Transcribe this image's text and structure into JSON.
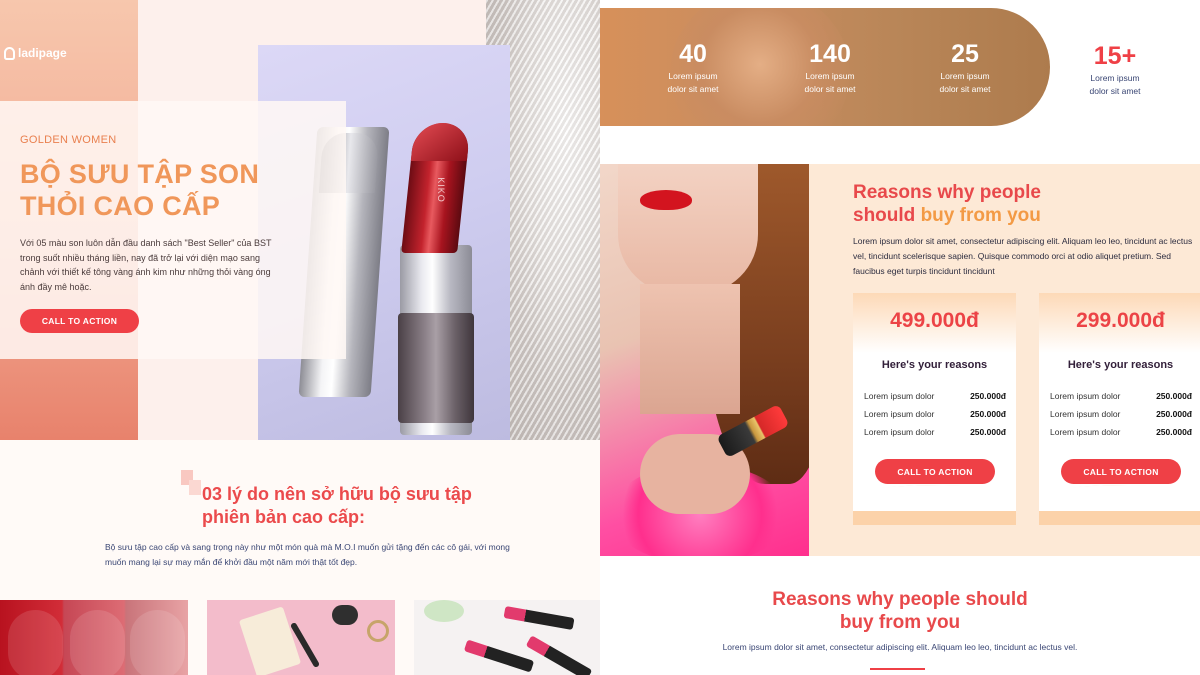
{
  "brand": {
    "logo_text": "ladipage"
  },
  "hero": {
    "subtitle": "GOLDEN WOMEN",
    "title": "BỘ SƯU TẬP SON THỎI CAO CẤP",
    "description": "Với 05 màu son luôn dẫn đầu danh sách \"Best Seller\" của BST trong suốt nhiều tháng liền, nay đã trở lại với diện mạo sang chảnh với thiết kế tông vàng ánh kim như những thỏi vàng óng ánh đầy mê hoặc.",
    "cta": "CALL TO ACTION",
    "lipstick_brand": "KIKO"
  },
  "section2": {
    "title": "03 lý do nên sở hữu bộ sưu tập phiên bản cao cấp:",
    "description": "Bộ sưu tập cao cấp và sang trọng này như một món quà mà M.O.I muốn gửi tặng đến các cô gái, với mong muốn mang lại sự may mắn để khởi đầu một năm mới thật tốt đẹp."
  },
  "stats": [
    {
      "number": "40",
      "label_1": "Lorem ipsum",
      "label_2": "dolor sit amet"
    },
    {
      "number": "140",
      "label_1": "Lorem ipsum",
      "label_2": "dolor sit amet"
    },
    {
      "number": "25",
      "label_1": "Lorem ipsum",
      "label_2": "dolor sit amet"
    },
    {
      "number": "15+",
      "label_1": "Lorem ipsum",
      "label_2": "dolor sit amet"
    }
  ],
  "reasons": {
    "title_part1": "Reasons why people",
    "title_part2": "should",
    "title_highlight": "buy from you",
    "description": "Lorem ipsum dolor sit amet, consectetur adipiscing elit. Aliquam leo leo, tincidunt ac lectus vel, tincidunt scelerisque sapien. Quisque commodo orci at odio aliquet pretium. Sed faucibus eget turpis tincidunt tincidunt"
  },
  "pricing_cards": [
    {
      "price": "499.000đ",
      "heading": "Here's your reasons",
      "rows": [
        {
          "label": "Lorem ipsum dolor",
          "value": "250.000đ"
        },
        {
          "label": "Lorem ipsum dolor",
          "value": "250.000đ"
        },
        {
          "label": "Lorem ipsum dolor",
          "value": "250.000đ"
        }
      ],
      "cta": "CALL TO ACTION"
    },
    {
      "price": "299.000đ",
      "heading": "Here's your reasons",
      "rows": [
        {
          "label": "Lorem ipsum dolor",
          "value": "250.000đ"
        },
        {
          "label": "Lorem ipsum dolor",
          "value": "250.000đ"
        },
        {
          "label": "Lorem ipsum dolor",
          "value": "250.000đ"
        }
      ],
      "cta": "CALL TO ACTION"
    }
  ],
  "reasons2": {
    "title_line1": "Reasons why people should",
    "title_line2": "buy from you",
    "description": "Lorem ipsum dolor sit amet, consectetur adipiscing elit. Aliquam leo leo, tincidunt ac lectus vel."
  },
  "colors": {
    "accent_red": "#ef4046",
    "accent_orange": "#f0975a",
    "peach_bg": "#fde9d6",
    "navy_text": "#3a4674"
  }
}
